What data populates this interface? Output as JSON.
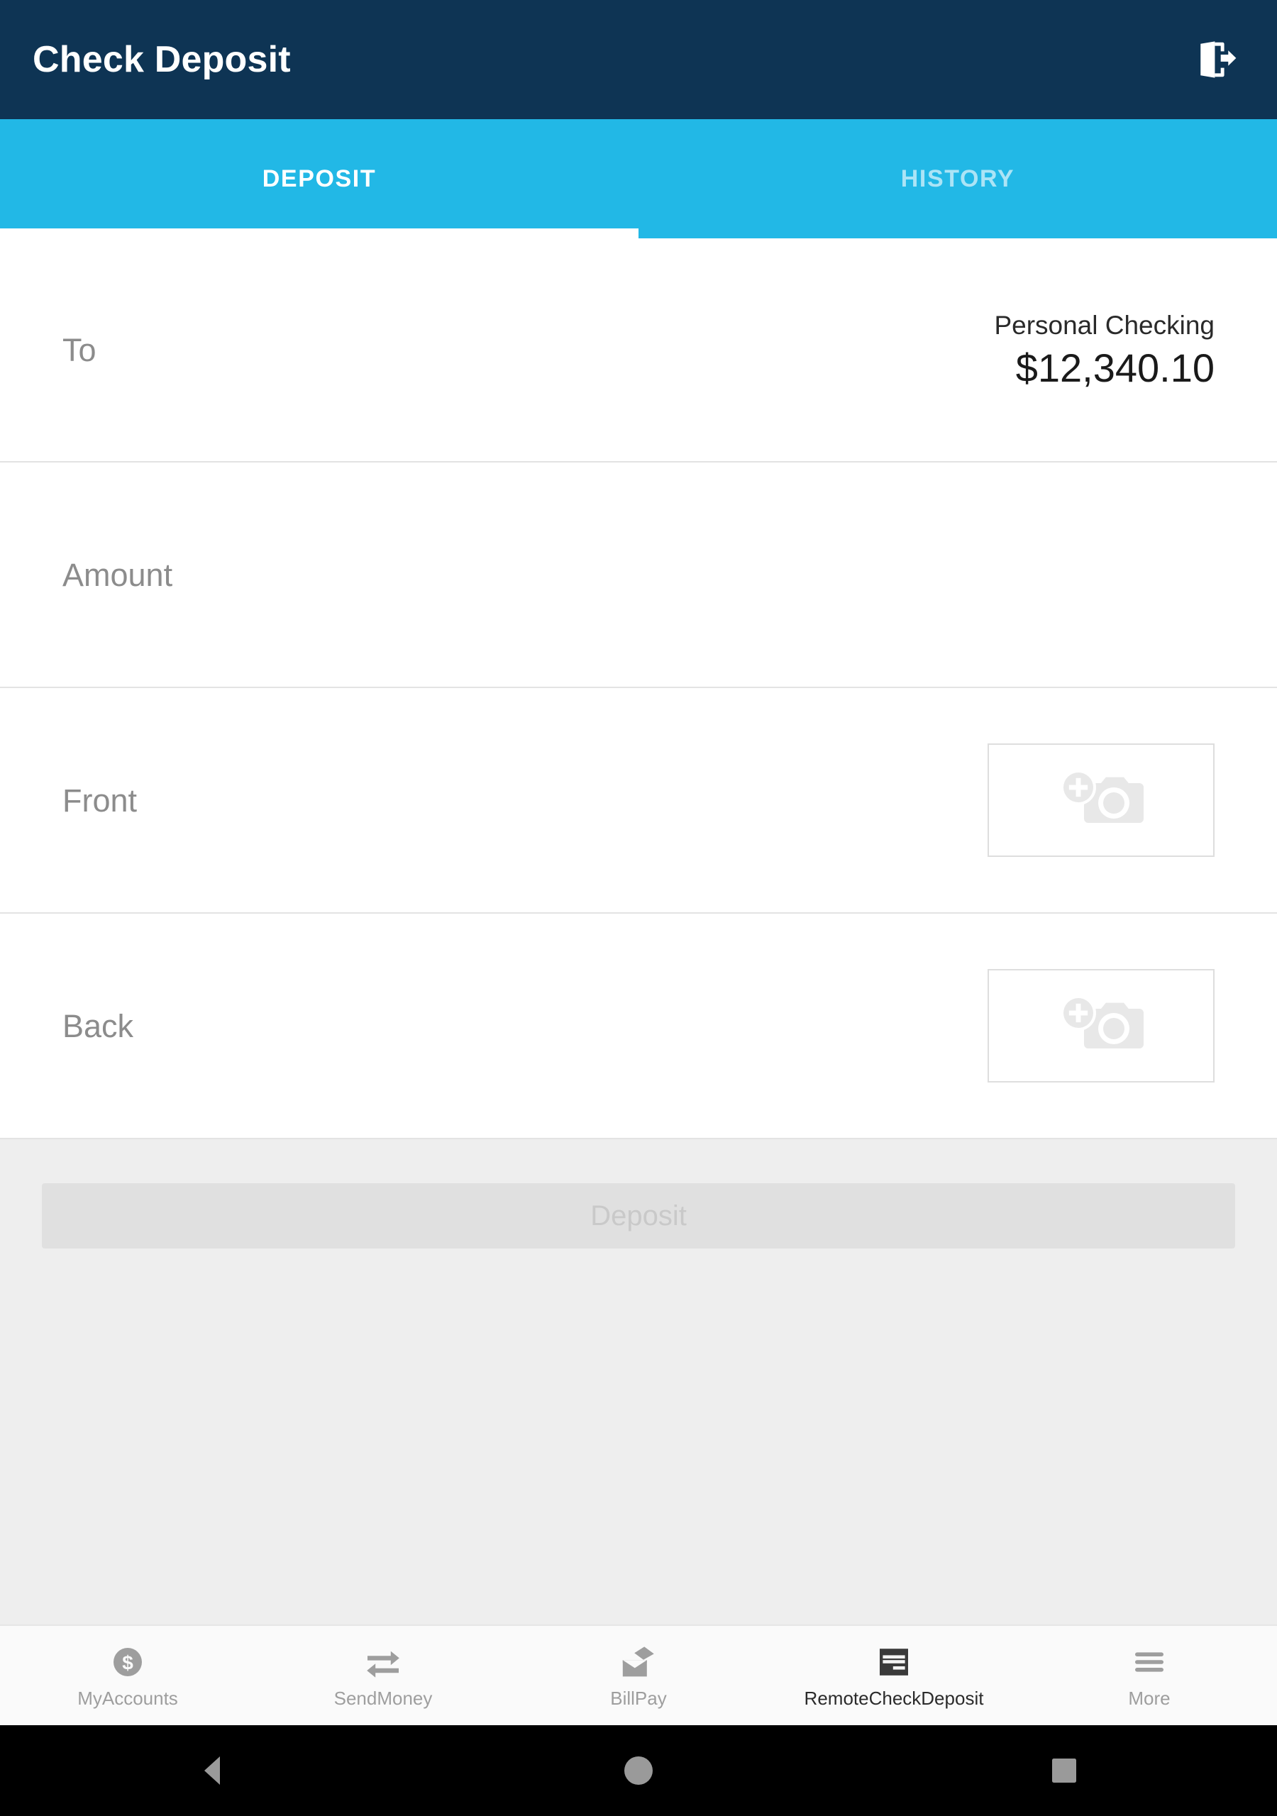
{
  "appbar": {
    "title": "Check Deposit",
    "logout_icon": "logout-door-arrow-icon",
    "bg_color": "#0e3454"
  },
  "tabs": {
    "accent_color": "#22b8e6",
    "active_index": 0,
    "items": [
      {
        "label": "DEPOSIT",
        "active": true
      },
      {
        "label": "HISTORY",
        "active": false
      }
    ]
  },
  "form": {
    "to": {
      "label": "To",
      "account_name": "Personal Checking",
      "account_balance": "$12,340.10"
    },
    "amount": {
      "label": "Amount",
      "value": "",
      "placeholder": "Amount"
    },
    "front": {
      "label": "Front",
      "capture_icon": "add-photo-camera-icon"
    },
    "back": {
      "label": "Back",
      "capture_icon": "add-photo-camera-icon"
    }
  },
  "deposit_button": {
    "label": "Deposit",
    "enabled": false,
    "bg_color": "#e0e0e0",
    "text_color": "#c9c9c9"
  },
  "bottom_nav": {
    "active_index": 3,
    "items": [
      {
        "label": "MyAccounts",
        "icon": "dollar-circle-icon",
        "active": false
      },
      {
        "label": "SendMoney",
        "icon": "transfer-arrows-icon",
        "active": false
      },
      {
        "label": "BillPay",
        "icon": "envelope-pen-icon",
        "active": false
      },
      {
        "label": "RemoteCheckDeposit",
        "icon": "check-document-icon",
        "active": true
      },
      {
        "label": "More",
        "icon": "hamburger-menu-icon",
        "active": false
      }
    ]
  },
  "system_nav": {
    "back": "back-triangle-icon",
    "home": "home-circle-icon",
    "recents": "recents-square-icon"
  }
}
